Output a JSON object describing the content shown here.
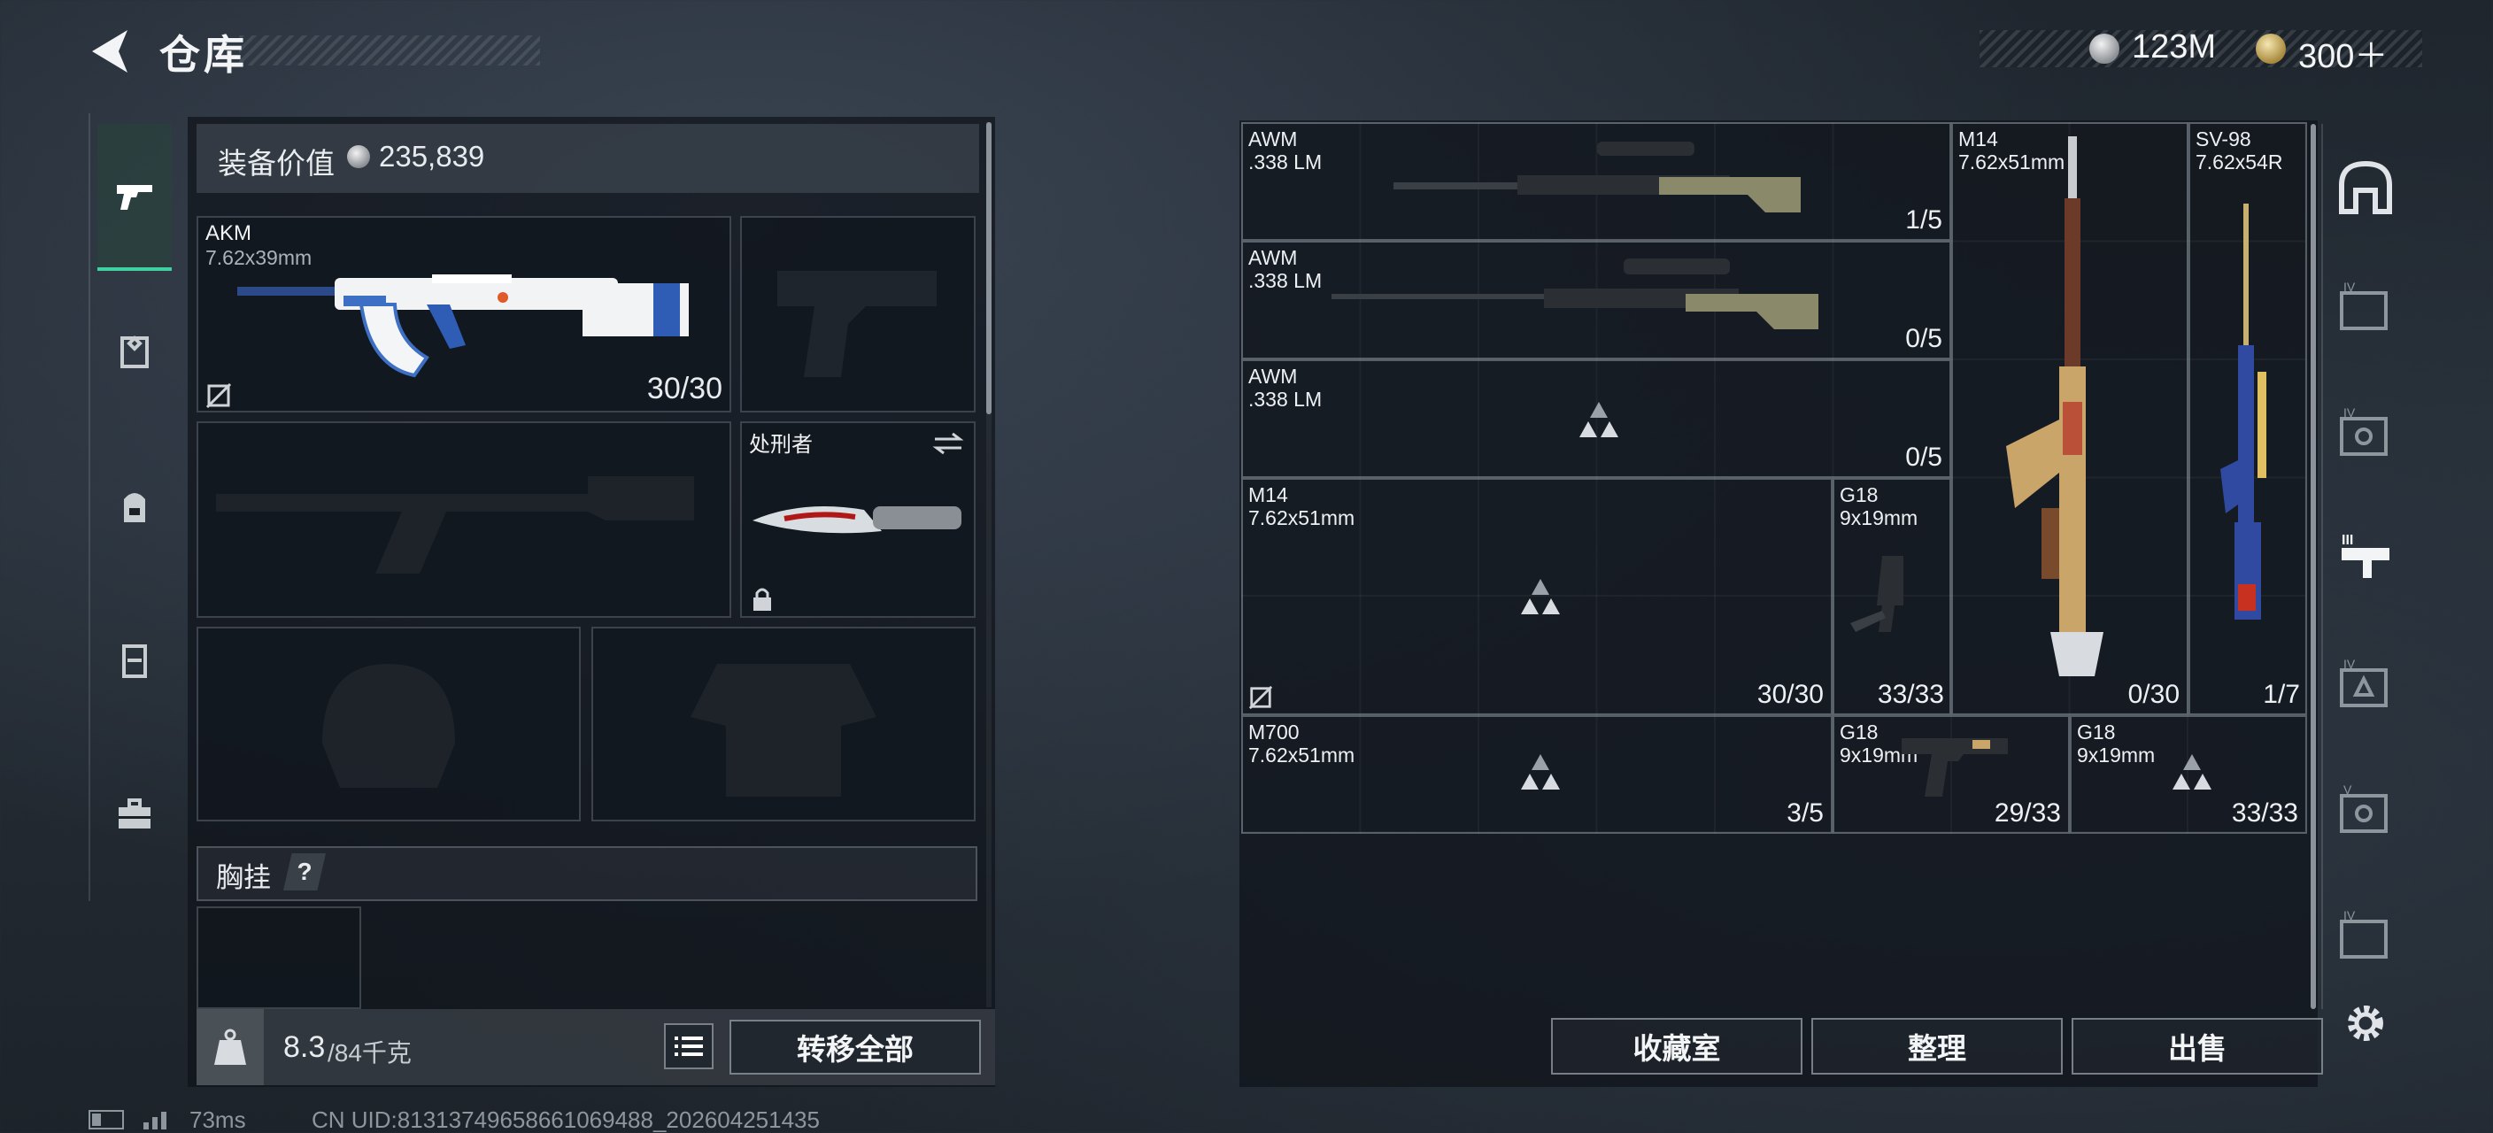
{
  "header": {
    "title": "仓库",
    "currency_silver": "123M",
    "currency_gold": "300＋"
  },
  "loadout": {
    "value_label": "装备价值",
    "value_amount": "235,839",
    "primary": {
      "name": "AKM",
      "caliber": "7.62x39mm",
      "count": "30/30"
    },
    "melee": {
      "name": "处刑者"
    },
    "chest_rig_label": "胸挂",
    "chest_rig_help": "?",
    "weight_current": "8.3",
    "weight_max": "/84千克",
    "weight_icon_label": "KG",
    "transfer_all": "转移全部"
  },
  "stash": {
    "items": [
      {
        "name": "AWM",
        "caliber": ".338 LM",
        "count": "1/5"
      },
      {
        "name": "AWM",
        "caliber": ".338 LM",
        "count": "0/5"
      },
      {
        "name": "AWM",
        "caliber": ".338 LM",
        "count": "0/5"
      },
      {
        "name": "M14",
        "caliber": "7.62x51mm",
        "count": "30/30"
      },
      {
        "name": "G18",
        "caliber": "9x19mm",
        "count": "33/33"
      },
      {
        "name": "M14",
        "caliber": "7.62x51mm",
        "count": "0/30"
      },
      {
        "name": "SV-98",
        "caliber": "7.62x54R",
        "count": "1/7"
      },
      {
        "name": "M700",
        "caliber": "7.62x51mm",
        "count": "3/5"
      },
      {
        "name": "G18",
        "caliber": "9x19mm",
        "count": "29/33"
      },
      {
        "name": "G18",
        "caliber": "9x19mm",
        "count": "33/33"
      }
    ],
    "buttons": {
      "collection": "收藏室",
      "organize": "整理",
      "sell": "出售"
    }
  },
  "footer": {
    "ping": "73ms",
    "uid": "CN UID:813137496586610694​88_202604251435"
  },
  "colors": {
    "accent": "#3fd1a2",
    "panel": "#0f141a",
    "text": "#e8ecef"
  }
}
